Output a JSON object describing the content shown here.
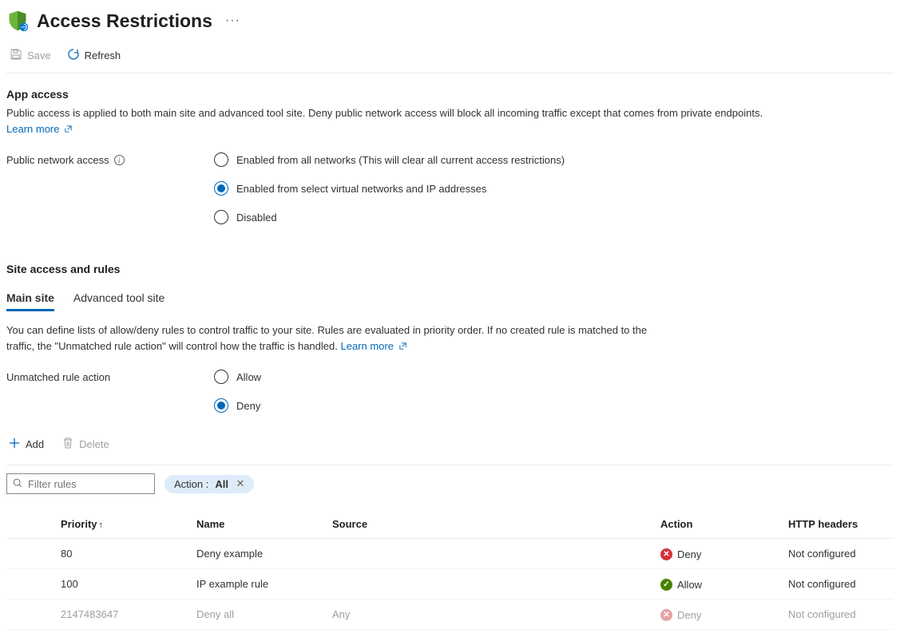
{
  "header": {
    "title": "Access Restrictions"
  },
  "commands": {
    "save": "Save",
    "refresh": "Refresh"
  },
  "appAccess": {
    "title": "App access",
    "description": "Public access is applied to both main site and advanced tool site. Deny public network access will block all incoming traffic except that comes from private endpoints.",
    "learnMore": "Learn more",
    "publicNetworkLabel": "Public network access",
    "options": {
      "all": "Enabled from all networks (This will clear all current access restrictions)",
      "select": "Enabled from select virtual networks and IP addresses",
      "disabled": "Disabled"
    },
    "selected": "select"
  },
  "siteAccess": {
    "title": "Site access and rules",
    "tabs": {
      "main": "Main site",
      "advanced": "Advanced tool site"
    },
    "activeTab": "main",
    "description": "You can define lists of allow/deny rules to control traffic to your site. Rules are evaluated in priority order. If no created rule is matched to the traffic, the \"Unmatched rule action\" will control how the traffic is handled.",
    "learnMore": "Learn more",
    "unmatchedLabel": "Unmatched rule action",
    "unmatchedOptions": {
      "allow": "Allow",
      "deny": "Deny"
    },
    "unmatchedSelected": "deny"
  },
  "rulesToolbar": {
    "add": "Add",
    "delete": "Delete",
    "filterPlaceholder": "Filter rules",
    "chipPrefix": "Action : ",
    "chipValue": "All"
  },
  "columns": {
    "priority": "Priority",
    "name": "Name",
    "source": "Source",
    "action": "Action",
    "http": "HTTP headers"
  },
  "rows": [
    {
      "priority": "80",
      "name": "Deny example",
      "source": "",
      "action": "Deny",
      "actionKind": "deny",
      "http": "Not configured",
      "dim": false
    },
    {
      "priority": "100",
      "name": "IP example rule",
      "source": "",
      "action": "Allow",
      "actionKind": "allow",
      "http": "Not configured",
      "dim": false
    },
    {
      "priority": "2147483647",
      "name": "Deny all",
      "source": "Any",
      "action": "Deny",
      "actionKind": "deny",
      "http": "Not configured",
      "dim": true
    }
  ]
}
